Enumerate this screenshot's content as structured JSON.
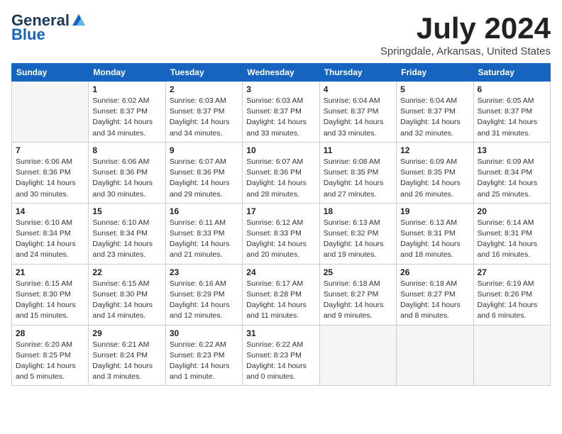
{
  "header": {
    "logo_line1": "General",
    "logo_line2": "Blue",
    "month": "July 2024",
    "location": "Springdale, Arkansas, United States"
  },
  "days_of_week": [
    "Sunday",
    "Monday",
    "Tuesday",
    "Wednesday",
    "Thursday",
    "Friday",
    "Saturday"
  ],
  "weeks": [
    [
      {
        "day": "",
        "info": ""
      },
      {
        "day": "1",
        "info": "Sunrise: 6:02 AM\nSunset: 8:37 PM\nDaylight: 14 hours\nand 34 minutes."
      },
      {
        "day": "2",
        "info": "Sunrise: 6:03 AM\nSunset: 8:37 PM\nDaylight: 14 hours\nand 34 minutes."
      },
      {
        "day": "3",
        "info": "Sunrise: 6:03 AM\nSunset: 8:37 PM\nDaylight: 14 hours\nand 33 minutes."
      },
      {
        "day": "4",
        "info": "Sunrise: 6:04 AM\nSunset: 8:37 PM\nDaylight: 14 hours\nand 33 minutes."
      },
      {
        "day": "5",
        "info": "Sunrise: 6:04 AM\nSunset: 8:37 PM\nDaylight: 14 hours\nand 32 minutes."
      },
      {
        "day": "6",
        "info": "Sunrise: 6:05 AM\nSunset: 8:37 PM\nDaylight: 14 hours\nand 31 minutes."
      }
    ],
    [
      {
        "day": "7",
        "info": "Sunrise: 6:06 AM\nSunset: 8:36 PM\nDaylight: 14 hours\nand 30 minutes."
      },
      {
        "day": "8",
        "info": "Sunrise: 6:06 AM\nSunset: 8:36 PM\nDaylight: 14 hours\nand 30 minutes."
      },
      {
        "day": "9",
        "info": "Sunrise: 6:07 AM\nSunset: 8:36 PM\nDaylight: 14 hours\nand 29 minutes."
      },
      {
        "day": "10",
        "info": "Sunrise: 6:07 AM\nSunset: 8:36 PM\nDaylight: 14 hours\nand 28 minutes."
      },
      {
        "day": "11",
        "info": "Sunrise: 6:08 AM\nSunset: 8:35 PM\nDaylight: 14 hours\nand 27 minutes."
      },
      {
        "day": "12",
        "info": "Sunrise: 6:09 AM\nSunset: 8:35 PM\nDaylight: 14 hours\nand 26 minutes."
      },
      {
        "day": "13",
        "info": "Sunrise: 6:09 AM\nSunset: 8:34 PM\nDaylight: 14 hours\nand 25 minutes."
      }
    ],
    [
      {
        "day": "14",
        "info": "Sunrise: 6:10 AM\nSunset: 8:34 PM\nDaylight: 14 hours\nand 24 minutes."
      },
      {
        "day": "15",
        "info": "Sunrise: 6:10 AM\nSunset: 8:34 PM\nDaylight: 14 hours\nand 23 minutes."
      },
      {
        "day": "16",
        "info": "Sunrise: 6:11 AM\nSunset: 8:33 PM\nDaylight: 14 hours\nand 21 minutes."
      },
      {
        "day": "17",
        "info": "Sunrise: 6:12 AM\nSunset: 8:33 PM\nDaylight: 14 hours\nand 20 minutes."
      },
      {
        "day": "18",
        "info": "Sunrise: 6:13 AM\nSunset: 8:32 PM\nDaylight: 14 hours\nand 19 minutes."
      },
      {
        "day": "19",
        "info": "Sunrise: 6:13 AM\nSunset: 8:31 PM\nDaylight: 14 hours\nand 18 minutes."
      },
      {
        "day": "20",
        "info": "Sunrise: 6:14 AM\nSunset: 8:31 PM\nDaylight: 14 hours\nand 16 minutes."
      }
    ],
    [
      {
        "day": "21",
        "info": "Sunrise: 6:15 AM\nSunset: 8:30 PM\nDaylight: 14 hours\nand 15 minutes."
      },
      {
        "day": "22",
        "info": "Sunrise: 6:15 AM\nSunset: 8:30 PM\nDaylight: 14 hours\nand 14 minutes."
      },
      {
        "day": "23",
        "info": "Sunrise: 6:16 AM\nSunset: 8:29 PM\nDaylight: 14 hours\nand 12 minutes."
      },
      {
        "day": "24",
        "info": "Sunrise: 6:17 AM\nSunset: 8:28 PM\nDaylight: 14 hours\nand 11 minutes."
      },
      {
        "day": "25",
        "info": "Sunrise: 6:18 AM\nSunset: 8:27 PM\nDaylight: 14 hours\nand 9 minutes."
      },
      {
        "day": "26",
        "info": "Sunrise: 6:18 AM\nSunset: 8:27 PM\nDaylight: 14 hours\nand 8 minutes."
      },
      {
        "day": "27",
        "info": "Sunrise: 6:19 AM\nSunset: 8:26 PM\nDaylight: 14 hours\nand 6 minutes."
      }
    ],
    [
      {
        "day": "28",
        "info": "Sunrise: 6:20 AM\nSunset: 8:25 PM\nDaylight: 14 hours\nand 5 minutes."
      },
      {
        "day": "29",
        "info": "Sunrise: 6:21 AM\nSunset: 8:24 PM\nDaylight: 14 hours\nand 3 minutes."
      },
      {
        "day": "30",
        "info": "Sunrise: 6:22 AM\nSunset: 8:23 PM\nDaylight: 14 hours\nand 1 minute."
      },
      {
        "day": "31",
        "info": "Sunrise: 6:22 AM\nSunset: 8:23 PM\nDaylight: 14 hours\nand 0 minutes."
      },
      {
        "day": "",
        "info": ""
      },
      {
        "day": "",
        "info": ""
      },
      {
        "day": "",
        "info": ""
      }
    ]
  ]
}
